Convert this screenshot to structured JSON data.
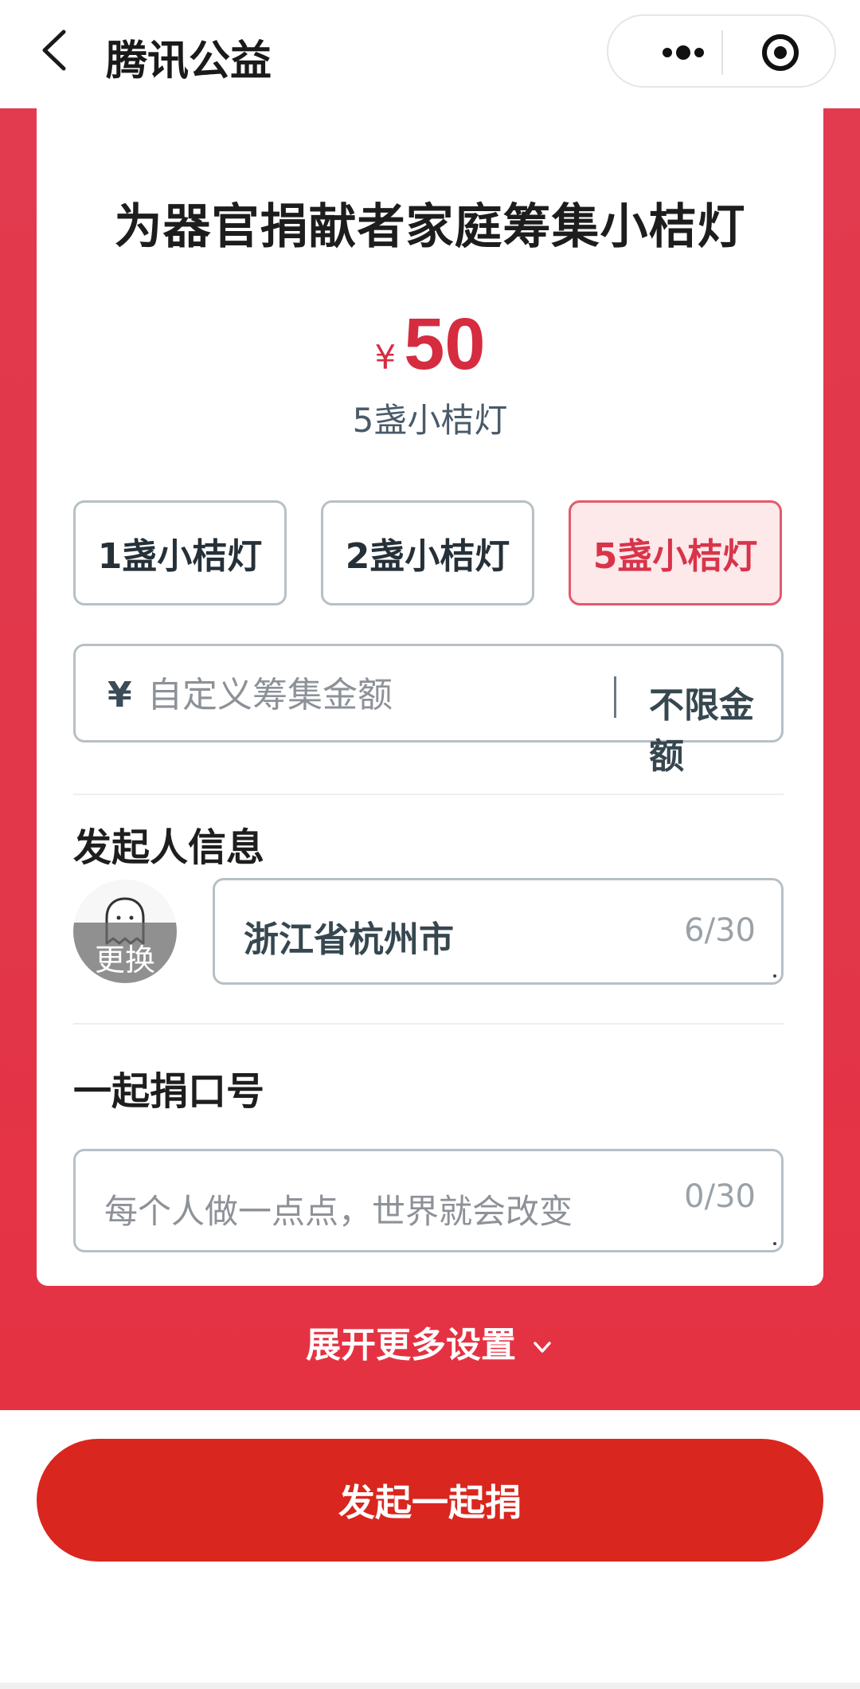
{
  "navbar": {
    "title": "腾讯公益"
  },
  "campaign": {
    "title": "为器官捐献者家庭筹集小桔灯",
    "currency_symbol": "¥",
    "amount": "50",
    "amount_desc": "5盏小桔灯"
  },
  "options": [
    {
      "label": "1盏小桔灯",
      "selected": false
    },
    {
      "label": "2盏小桔灯",
      "selected": false
    },
    {
      "label": "5盏小桔灯",
      "selected": true
    }
  ],
  "custom_amount": {
    "currency_symbol": "¥",
    "placeholder": "自定义筹集金额",
    "unlimited_label": "不限金额"
  },
  "initiator": {
    "section_title": "发起人信息",
    "avatar_change_label": "更换",
    "name_value": "浙江省杭州市",
    "name_counter": "6/30"
  },
  "slogan": {
    "section_title": "一起捐口号",
    "placeholder": "每个人做一点点，世界就会改变",
    "counter": "0/30"
  },
  "expand_label": "展开更多设置",
  "submit_label": "发起一起捐",
  "colors": {
    "brand_red": "#e2364a",
    "button_red": "#d9261e",
    "selected_text": "#d8344a",
    "selected_bg": "#fde8ea"
  }
}
